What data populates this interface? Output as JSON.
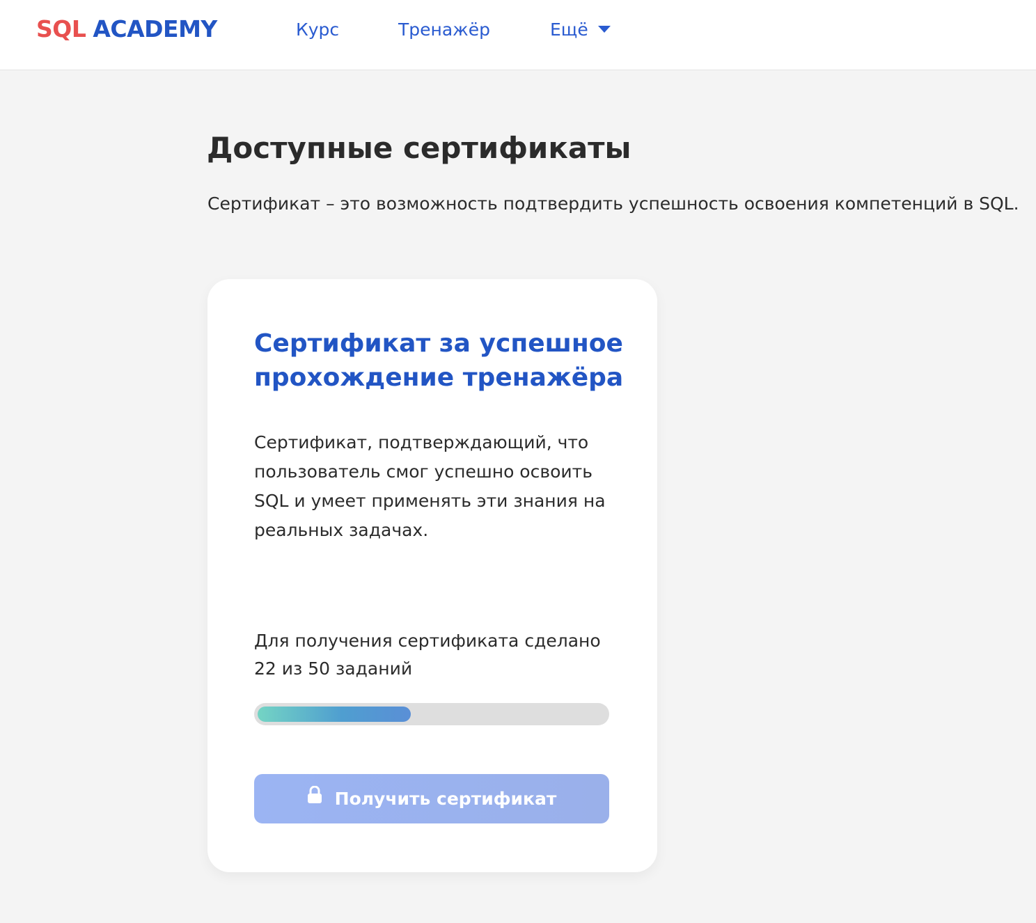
{
  "header": {
    "logo": {
      "part1": "SQL",
      "part2": "ACADEMY"
    },
    "nav": [
      {
        "label": "Курс"
      },
      {
        "label": "Тренажёр"
      },
      {
        "label": "Ещё"
      }
    ],
    "more_icon": "chevron-down-icon"
  },
  "main": {
    "title": "Доступные сертификаты",
    "subtitle": "Сертификат – это возможность подтвердить успешность освоения компетенций в SQL."
  },
  "card": {
    "title": "Сертификат за успешное прохождение тренажёра",
    "description": "Сертификат, подтверждающий, что пользователь смог успешно освоить SQL и умеет применять эти знания на реальных задачах.",
    "progress_text": "Для получения сертификата сделано 22 из 50 заданий",
    "progress": {
      "done": 22,
      "total": 50,
      "fraction": 0.44
    },
    "button_label": "Получить сертификат",
    "button_icon": "lock-icon"
  },
  "colors": {
    "brand_red": "#e8504f",
    "brand_blue": "#2255c4",
    "nav_blue": "#2a5bd0",
    "button_disabled": "#9bb4f3"
  }
}
